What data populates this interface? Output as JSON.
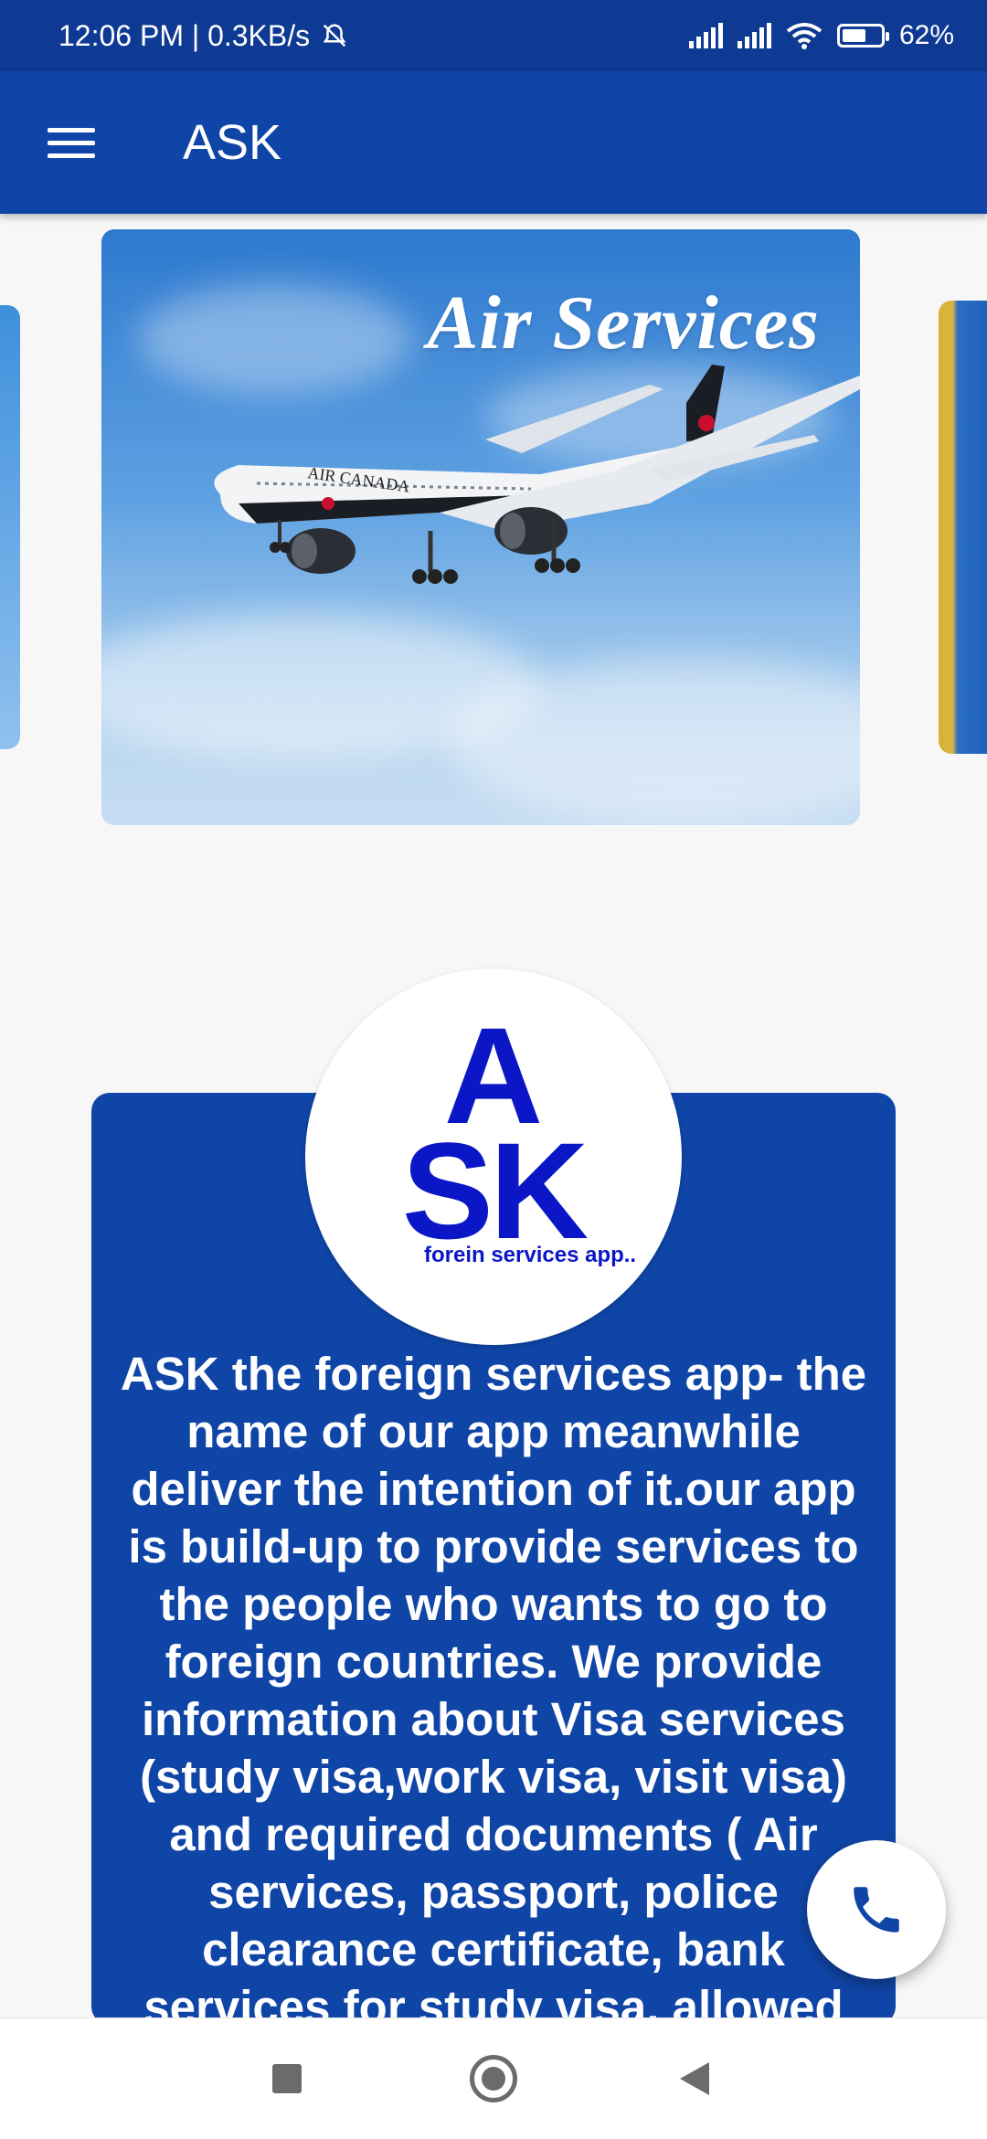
{
  "status_bar": {
    "time_speed": "12:06 PM | 0.3KB/s",
    "battery_percent": "62%",
    "battery_level": 0.62
  },
  "app_bar": {
    "title": "ASK"
  },
  "carousel": {
    "active_slide_title": "Air Services",
    "airline_text": "AIR CANADA"
  },
  "logo": {
    "letters_top": "A",
    "letters_bottom": "SK",
    "tagline": "forein services app.."
  },
  "about": {
    "text": "ASK the foreign services app- the name of our app meanwhile deliver the intention of it.our app is build-up to provide services to the people who wants to go to foreign countries. We provide information about Visa services (study visa,work visa, visit visa) and required documents ( Air services, passport, police clearance certificate,  bank services for study visa, allowed"
  },
  "colors": {
    "primary": "#0f45a6",
    "status_bar": "#0e3a94",
    "logo_blue": "#0b17c6"
  },
  "icons": {
    "menu": "hamburger-menu-icon",
    "call": "phone-icon",
    "recents": "square-icon",
    "home": "circle-icon",
    "back": "triangle-back-icon"
  }
}
